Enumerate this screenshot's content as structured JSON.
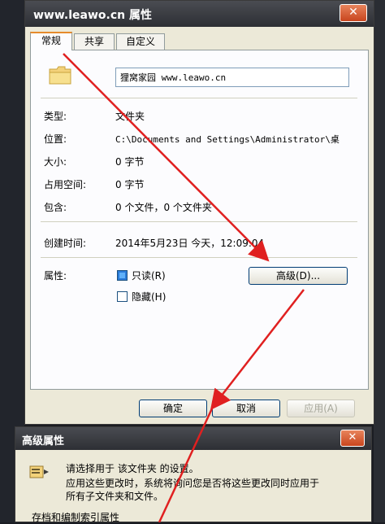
{
  "window": {
    "title": "www.leawo.cn 属性",
    "close_glyph": "✕",
    "tabs": [
      {
        "label": "常规",
        "active": true
      },
      {
        "label": "共享",
        "active": false
      },
      {
        "label": "自定义",
        "active": false
      }
    ],
    "folder_name": "狸窝家园 www.leawo.cn",
    "props": {
      "type_label": "类型:",
      "type_value": "文件夹",
      "location_label": "位置:",
      "location_value": "C:\\Documents and Settings\\Administrator\\桌",
      "size_label": "大小:",
      "size_value": "0 字节",
      "disk_label": "占用空间:",
      "disk_value": "0 字节",
      "contains_label": "包含:",
      "contains_value": "0 个文件，0 个文件夹",
      "created_label": "创建时间:",
      "created_value": "2014年5月23日 今天，12:09:04",
      "attr_label": "属性:",
      "readonly_label": "只读(R)",
      "readonly_checked": true,
      "hidden_label": "隐藏(H)",
      "hidden_checked": false,
      "advanced_label": "高级(D)..."
    },
    "buttons": {
      "ok": "确定",
      "cancel": "取消",
      "apply": "应用(A)"
    }
  },
  "advanced_dialog": {
    "title": "高级属性",
    "close_glyph": "✕",
    "line1": "请选择用于 该文件夹 的设置。",
    "line2": "应用这些更改时，系统将询问您是否将这些更改同时应用于",
    "line3": "所有子文件夹和文件。",
    "line4": "存档和编制索引属性"
  },
  "colors": {
    "annotation_arrow": "#e02020",
    "title_bar": "#2d2f34",
    "dialog_bg": "#ece9d8"
  }
}
